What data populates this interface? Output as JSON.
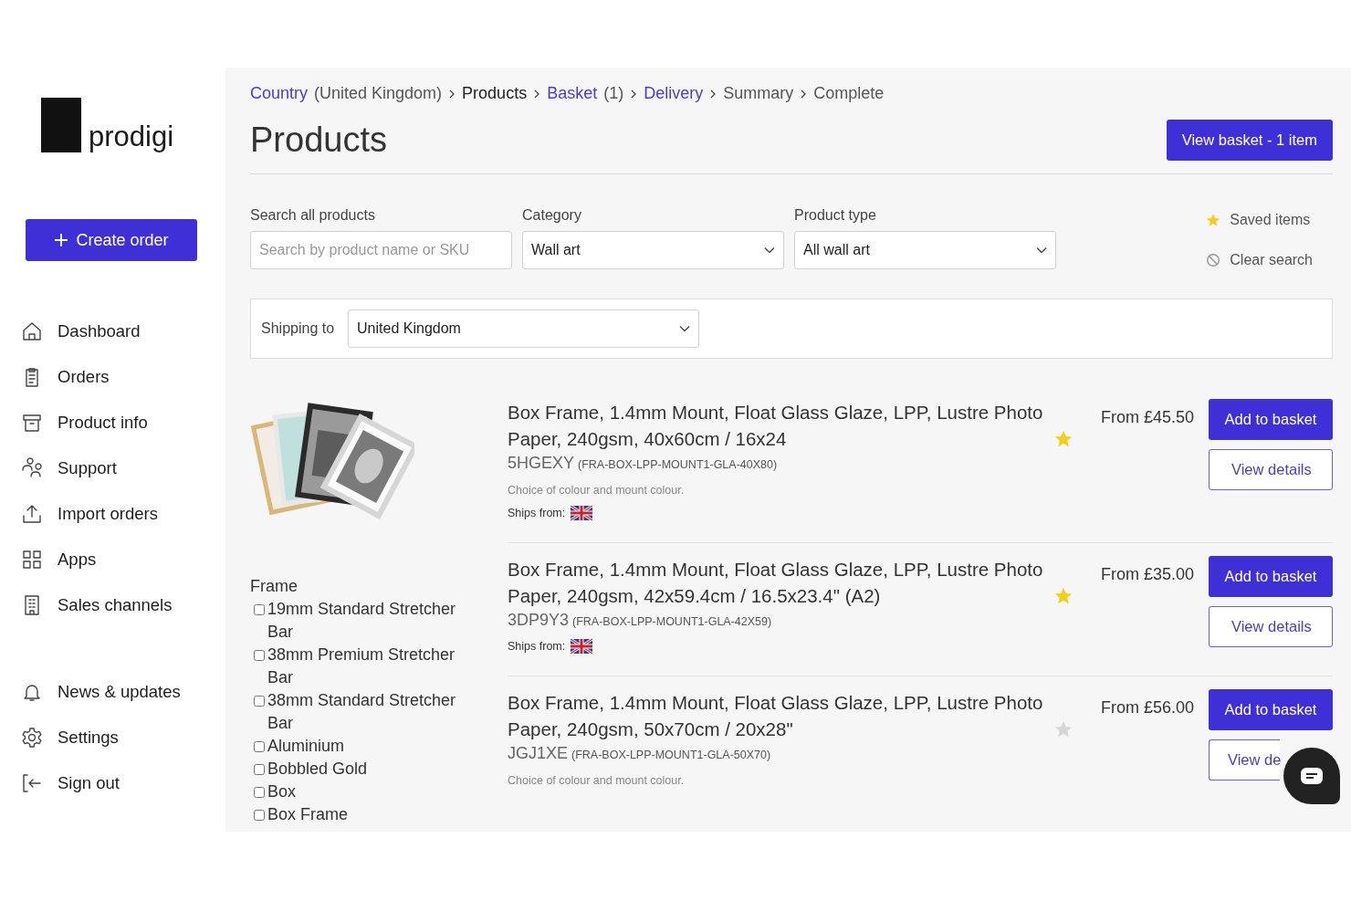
{
  "sidebar": {
    "logo": "prodigi",
    "create_button": "Create order",
    "nav_groups": [
      [
        {
          "label": "Dashboard"
        },
        {
          "label": "Orders"
        },
        {
          "label": "Product info"
        },
        {
          "label": "Support"
        },
        {
          "label": "Import orders"
        },
        {
          "label": "Apps"
        },
        {
          "label": "Sales channels"
        }
      ],
      [
        {
          "label": "News & updates"
        },
        {
          "label": "Settings"
        },
        {
          "label": "Sign out"
        }
      ]
    ]
  },
  "breadcrumb": [
    {
      "label": "Country",
      "suffix": "(United Kingdom)",
      "kind": "link"
    },
    {
      "label": "Products",
      "kind": "current"
    },
    {
      "label": "Basket",
      "suffix": "(1)",
      "kind": "link"
    },
    {
      "label": "Delivery",
      "kind": "link"
    },
    {
      "label": "Summary",
      "kind": "plain"
    },
    {
      "label": "Complete",
      "kind": "plain"
    }
  ],
  "title": "Products",
  "basket_button": "View basket - 1 item",
  "filters": {
    "search": {
      "label": "Search all products",
      "placeholder": "Search by product name or SKU"
    },
    "category": {
      "label": "Category",
      "value": "Wall art"
    },
    "product_type": {
      "label": "Product type",
      "value": "All wall art"
    },
    "saved_items": "Saved items",
    "clear_search": "Clear search"
  },
  "shipping": {
    "label": "Shipping to",
    "value": "United Kingdom"
  },
  "facet": {
    "title": "Frame",
    "options": [
      {
        "label": "19mm Standard Stretcher Bar",
        "checked": false
      },
      {
        "label": "38mm Premium Stretcher Bar",
        "checked": false
      },
      {
        "label": "38mm Standard Stretcher Bar",
        "checked": false
      },
      {
        "label": "Aluminium",
        "checked": false
      },
      {
        "label": "Bobbled Gold",
        "checked": false
      },
      {
        "label": "Box",
        "checked": false
      },
      {
        "label": "Box Frame",
        "checked": false
      }
    ]
  },
  "products": [
    {
      "title": "Box Frame, 1.4mm Mount, Float Glass Glaze, LPP, Lustre Photo Paper, 240gsm, 40x60cm / 16x24",
      "saved": true,
      "code": "5HGEXY",
      "sku": "(FRA-BOX-LPP-MOUNT1-GLA-40X80)",
      "note": "Choice of colour and mount colour.",
      "ships_from": "Ships from:",
      "price": "From £45.50",
      "add_button": "Add to basket",
      "details_button": "View details"
    },
    {
      "title": "Box Frame, 1.4mm Mount, Float Glass Glaze, LPP, Lustre Photo Paper, 240gsm, 42x59.4cm / 16.5x23.4\" (A2)",
      "saved": true,
      "code": "3DP9Y3",
      "sku": "(FRA-BOX-LPP-MOUNT1-GLA-42X59)",
      "ships_from": "Ships from:",
      "price": "From £35.00",
      "add_button": "Add to basket",
      "details_button": "View details"
    },
    {
      "title": "Box Frame, 1.4mm Mount, Float Glass Glaze, LPP, Lustre Photo Paper, 240gsm, 50x70cm / 20x28\"",
      "saved": false,
      "code": "JGJ1XE",
      "sku": "(FRA-BOX-LPP-MOUNT1-GLA-50X70)",
      "note": "Choice of colour and mount colour.",
      "price": "From £56.00",
      "add_button": "Add to basket",
      "details_button": "View de"
    }
  ]
}
